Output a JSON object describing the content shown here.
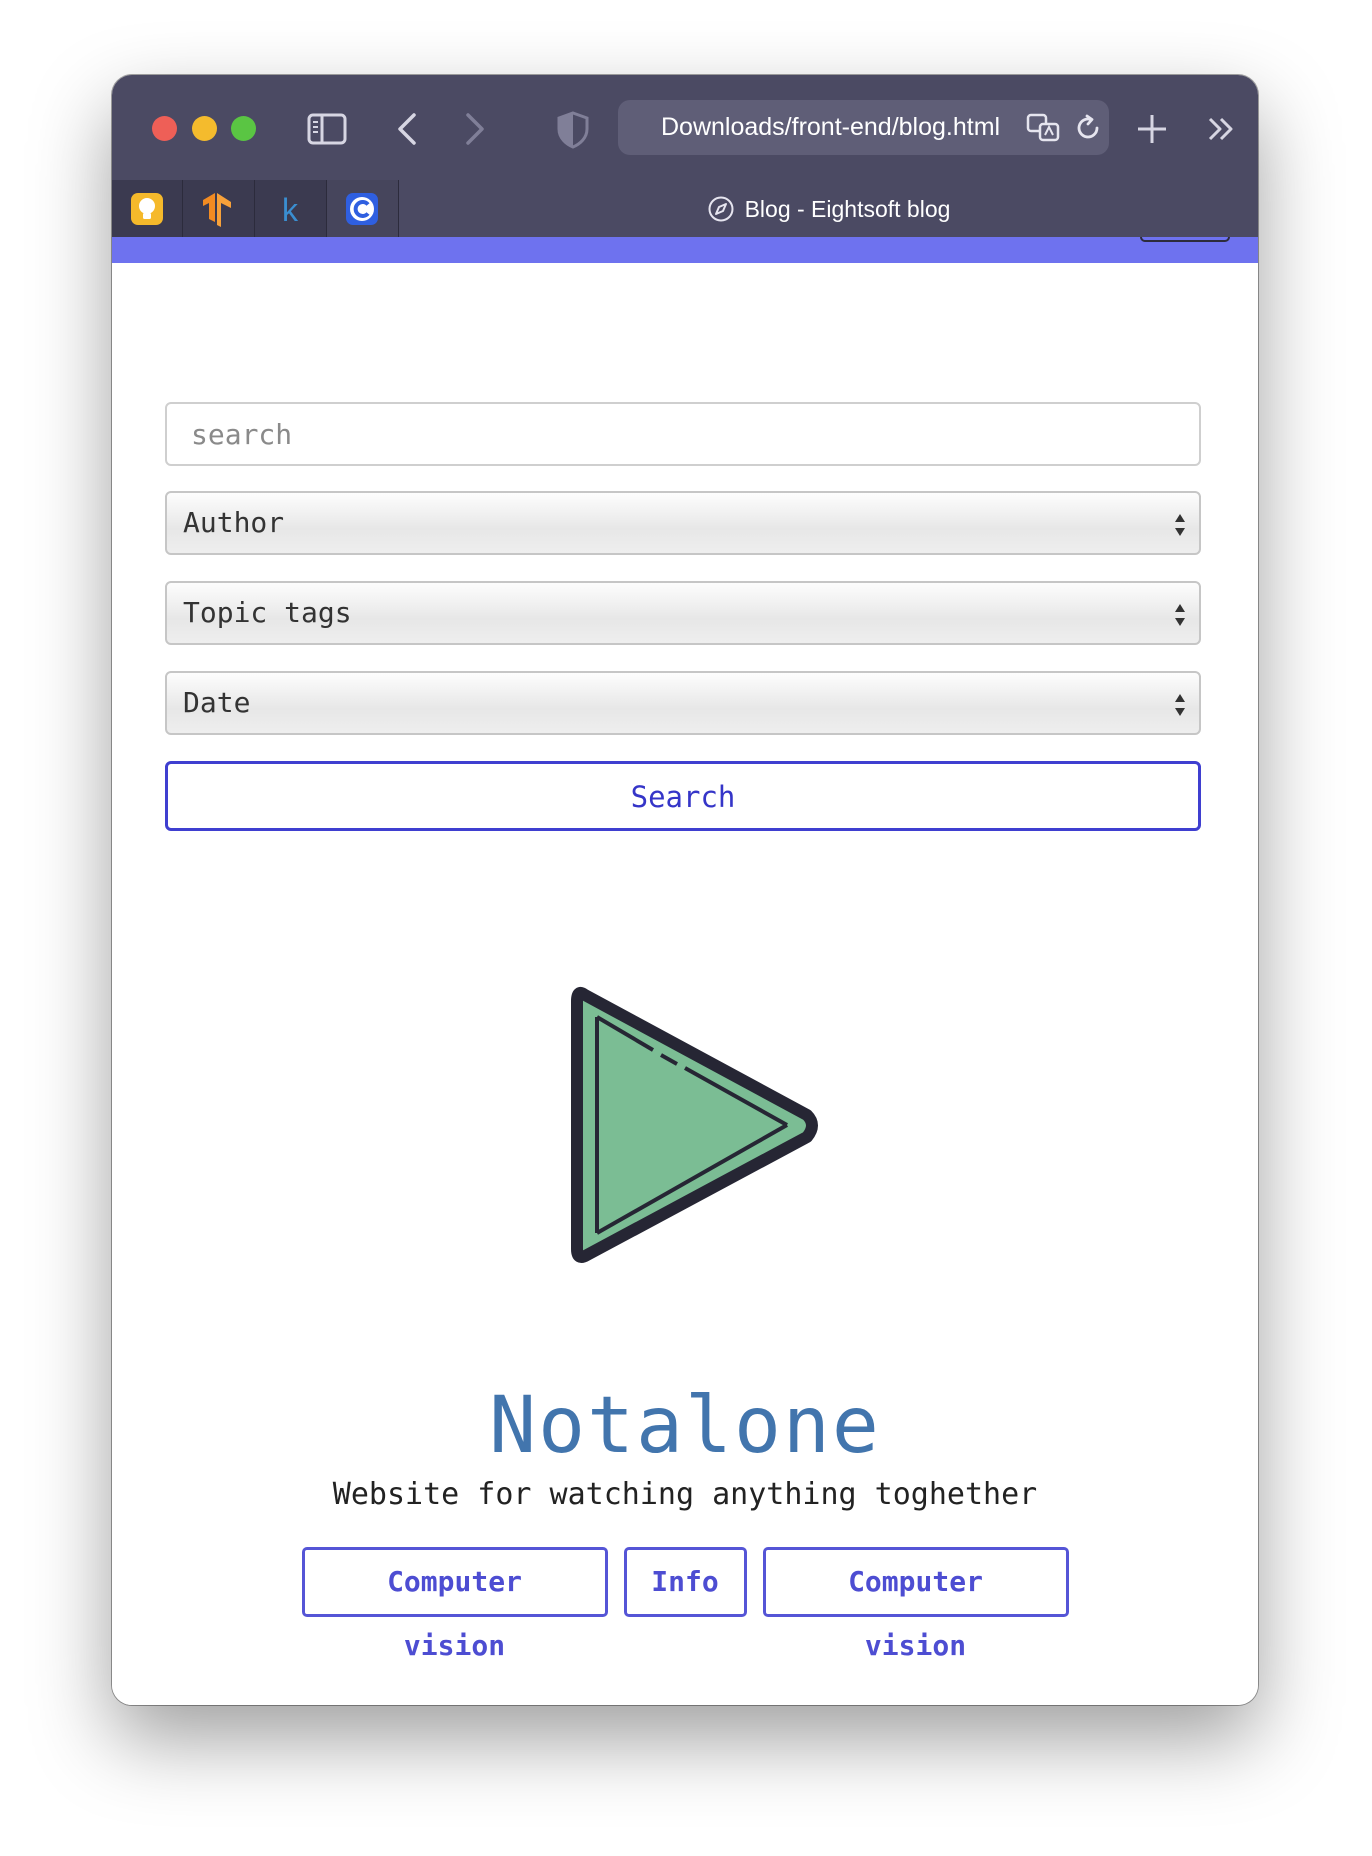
{
  "browser": {
    "url": "Downloads/front-end/blog.html",
    "tab_title": "Blog - Eightsoft blog",
    "pinned_tabs": [
      "bulb-icon",
      "tensorflow-icon",
      "k-icon",
      "c-icon"
    ],
    "colors": {
      "chrome": "#4b4a63",
      "accent_strip": "#6e72ef"
    }
  },
  "filters": {
    "search_placeholder": "search",
    "author": "Author",
    "topic_tags": "Topic tags",
    "date": "Date",
    "search_button": "Search"
  },
  "hero": {
    "title": "Notalone",
    "subtitle": "Website for watching anything toghether",
    "tags": [
      "Computer vision",
      "Info",
      "Computer vision"
    ],
    "colors": {
      "title": "#4275ad",
      "logo_fill": "#7bbd94",
      "button": "#4d4dd2"
    }
  }
}
